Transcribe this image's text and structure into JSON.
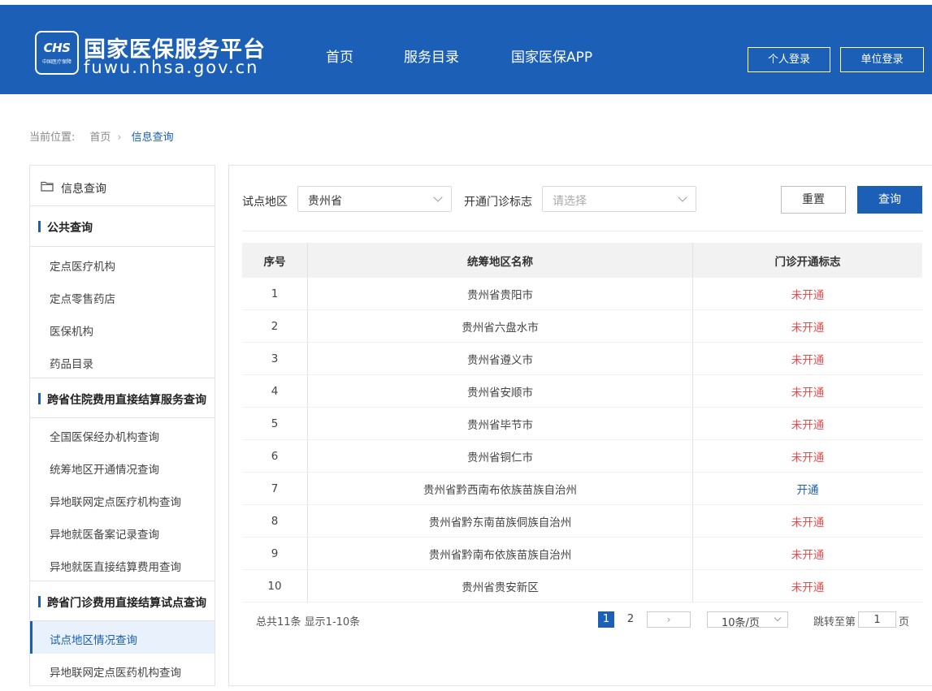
{
  "header": {
    "logo_text": "CHS",
    "logo_subtext": "中国医疗保障",
    "site_title": "国家医保服务平台",
    "site_url": "fuwu.nhsa.gov.cn",
    "nav": [
      "首页",
      "服务目录",
      "国家医保APP"
    ],
    "login_personal": "个人登录",
    "login_unit": "单位登录",
    "bg_color": "#1b5fb6"
  },
  "breadcrumb": {
    "prefix": "当前位置:",
    "home": "首页",
    "separator": "›",
    "current": "信息查询"
  },
  "sidebar": {
    "title": "信息查询",
    "groups": [
      {
        "label": "公共查询",
        "items": [
          "定点医疗机构",
          "定点零售药店",
          "医保机构",
          "药品目录"
        ]
      },
      {
        "label": "跨省住院费用直接结算服务查询",
        "items": [
          "全国医保经办机构查询",
          "统筹地区开通情况查询",
          "异地联网定点医疗机构查询",
          "异地就医备案记录查询",
          "异地就医直接结算费用查询"
        ]
      },
      {
        "label": "跨省门诊费用直接结算试点查询",
        "items": [
          "试点地区情况查询",
          "异地联网定点医药机构查询"
        ]
      }
    ],
    "active_item": "试点地区情况查询"
  },
  "filters": {
    "region_label": "试点地区",
    "region_value": "贵州省",
    "clinic_label": "开通门诊标志",
    "clinic_placeholder": "请选择",
    "reset_label": "重置",
    "search_label": "查询"
  },
  "table": {
    "columns": [
      "序号",
      "统筹地区名称",
      "门诊开通标志"
    ],
    "rows": [
      {
        "no": "1",
        "name": "贵州省贵阳市",
        "status": "未开通"
      },
      {
        "no": "2",
        "name": "贵州省六盘水市",
        "status": "未开通"
      },
      {
        "no": "3",
        "name": "贵州省遵义市",
        "status": "未开通"
      },
      {
        "no": "4",
        "name": "贵州省安顺市",
        "status": "未开通"
      },
      {
        "no": "5",
        "name": "贵州省毕节市",
        "status": "未开通"
      },
      {
        "no": "6",
        "name": "贵州省铜仁市",
        "status": "未开通"
      },
      {
        "no": "7",
        "name": "贵州省黔西南布依族苗族自治州",
        "status": "开通"
      },
      {
        "no": "8",
        "name": "贵州省黔东南苗族侗族自治州",
        "status": "未开通"
      },
      {
        "no": "9",
        "name": "贵州省黔南布依族苗族自治州",
        "status": "未开通"
      },
      {
        "no": "10",
        "name": "贵州省贵安新区",
        "status": "未开通"
      }
    ],
    "status_colors": {
      "未开通": "#e05050",
      "开通": "#1b5fb6"
    }
  },
  "pagination": {
    "summary": "总共11条  显示1-10条",
    "pages": [
      "1",
      "2"
    ],
    "current_page": "1",
    "next_icon": "›",
    "page_size": "10条/页",
    "jump_label": "跳转至第",
    "jump_value": "1",
    "jump_unit": "页"
  }
}
